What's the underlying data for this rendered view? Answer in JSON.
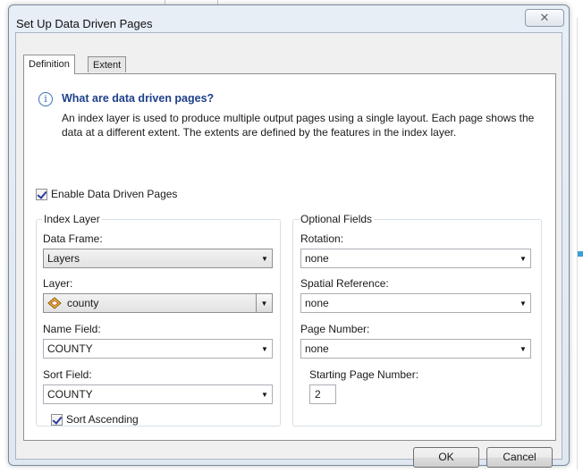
{
  "dialog": {
    "title": "Set Up Data Driven Pages",
    "close_symbol": "✕"
  },
  "tabs": [
    {
      "label": "Definition"
    },
    {
      "label": "Extent"
    }
  ],
  "info": {
    "icon_glyph": "i",
    "title": "What are data driven pages?",
    "body": "An index layer is used to produce multiple output pages using a single layout.  Each page shows the data at a different extent.  The extents are defined by the features in the index layer."
  },
  "enable_checkbox": {
    "label": "Enable Data Driven Pages",
    "checked": true
  },
  "index_layer": {
    "group_title": "Index Layer",
    "data_frame": {
      "label": "Data Frame:",
      "value": "Layers"
    },
    "layer": {
      "label": "Layer:",
      "value": "county",
      "icon": "polygon-layer-icon"
    },
    "name_field": {
      "label": "Name Field:",
      "value": "COUNTY"
    },
    "sort_field": {
      "label": "Sort Field:",
      "value": "COUNTY"
    },
    "sort_ascending": {
      "label": "Sort Ascending",
      "checked": true
    }
  },
  "optional_fields": {
    "group_title": "Optional Fields",
    "rotation": {
      "label": "Rotation:",
      "value": "none"
    },
    "spatial_reference": {
      "label": "Spatial Reference:",
      "value": "none"
    },
    "page_number": {
      "label": "Page Number:",
      "value": "none"
    },
    "starting_page_number": {
      "label": "Starting Page Number:",
      "value": "2"
    }
  },
  "buttons": {
    "ok": "OK",
    "cancel": "Cancel"
  },
  "colors": {
    "info_title": "#1e3f8a",
    "window_frame": "#dfe7f1",
    "accent_marker": "#3aa0d8"
  }
}
